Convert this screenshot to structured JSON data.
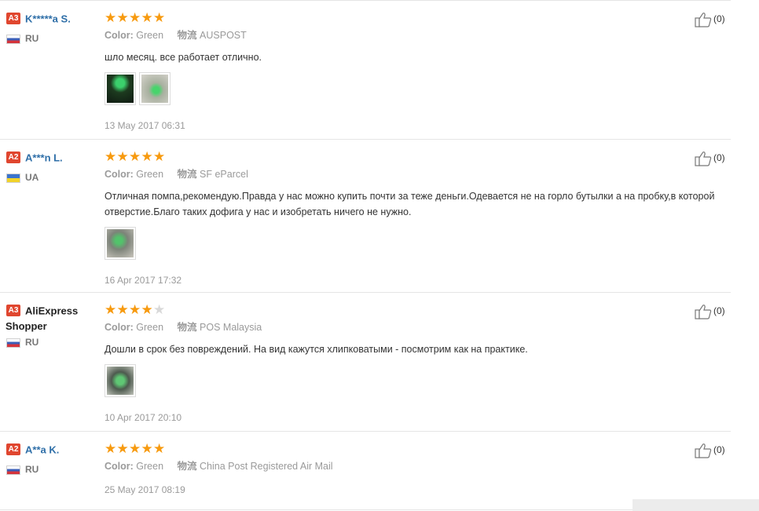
{
  "reviews": [
    {
      "badge": "A3",
      "name": "K*****a S.",
      "name_line2": "",
      "country": "RU",
      "flag": "ru",
      "rating": 5,
      "color_label": "Color:",
      "color_value": "Green",
      "logistics_label": "物流",
      "logistics_value": "AUSPOST",
      "text": "шло месяц. все работает отлично.",
      "photos": [
        "p1",
        "p2"
      ],
      "date": "13 May 2017 06:31",
      "likes": "(0)"
    },
    {
      "badge": "A2",
      "name": "A***n L.",
      "name_line2": "",
      "country": "UA",
      "flag": "ua",
      "rating": 5,
      "color_label": "Color:",
      "color_value": "Green",
      "logistics_label": "物流",
      "logistics_value": "SF eParcel",
      "text": "Отличная помпа,рекомендую.Правда у нас можно купить почти за теже деньги.Одевается не на горло бутылки а на пробку,в которой отверстие.Благо таких дофига у нас и изобретать ничего не нужно.",
      "photos": [
        "p3"
      ],
      "date": "16 Apr 2017 17:32",
      "likes": "(0)"
    },
    {
      "badge": "A3",
      "name": "AliExpress",
      "name_line2": "Shopper",
      "country": "RU",
      "flag": "ru",
      "rating": 4,
      "color_label": "Color:",
      "color_value": "Green",
      "logistics_label": "物流",
      "logistics_value": "POS Malaysia",
      "text": "Дошли в срок без повреждений. На вид кажутся хлипковатыми - посмотрим как на практике.",
      "photos": [
        "p4"
      ],
      "date": "10 Apr 2017 20:10",
      "likes": "(0)"
    },
    {
      "badge": "A2",
      "name": "A**a K.",
      "name_line2": "",
      "country": "RU",
      "flag": "ru",
      "rating": 5,
      "color_label": "Color:",
      "color_value": "Green",
      "logistics_label": "物流",
      "logistics_value": "China Post Registered Air Mail",
      "text": "",
      "photos": [],
      "date": "25 May 2017 08:19",
      "likes": "(0)"
    }
  ],
  "icons": {
    "like": "thumbs-up-icon",
    "star": "star-icon"
  },
  "colors": {
    "star": "#f79a0f",
    "badge": "#e0462f",
    "username": "#2f6fa8"
  }
}
